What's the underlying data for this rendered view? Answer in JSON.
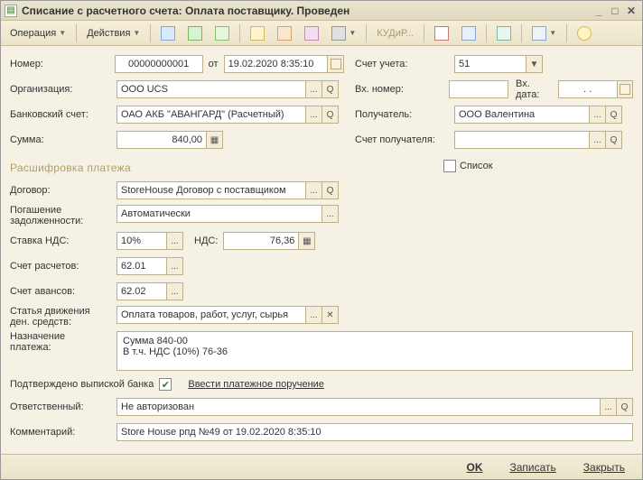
{
  "title": "Списание с расчетного счета: Оплата поставщику. Проведен",
  "toolbar": {
    "operation": "Операция",
    "actions": "Действия",
    "kudir": "КУДиР..."
  },
  "left": {
    "number_lbl": "Номер:",
    "number": "00000000001",
    "ot": "от",
    "date": "19.02.2020  8:35:10",
    "org_lbl": "Организация:",
    "org": "ООО UCS",
    "bank_lbl": "Банковский счет:",
    "bank": "ОАО АКБ \"АВАНГАРД\" (Расчетный)",
    "sum_lbl": "Сумма:",
    "sum": "840,00"
  },
  "right": {
    "account_lbl": "Счет учета:",
    "account": "51",
    "extnum_lbl": "Вх. номер:",
    "extnum": "",
    "extdate_lbl": "Вх. дата:",
    "extdate": ".  .",
    "recipient_lbl": "Получатель:",
    "recipient": "ООО Валентина",
    "recacct_lbl": "Счет получателя:",
    "recacct": ""
  },
  "section": {
    "title": "Расшифровка платежа",
    "list_chk_label": "Список",
    "contract_lbl": "Договор:",
    "contract": "StoreHouse Договор с поставщиком",
    "repay_lbl1": "Погашение",
    "repay_lbl2": "задолженности:",
    "repay": "Автоматически",
    "vatrate_lbl": "Ставка НДС:",
    "vatrate": "10%",
    "vat_lbl": "НДС:",
    "vat": "76,36",
    "settle_lbl": "Счет расчетов:",
    "settle": "62.01",
    "advance_lbl": "Счет авансов:",
    "advance": "62.02",
    "flow_lbl1": "Статья движения",
    "flow_lbl2": "ден. средств:",
    "flow": "Оплата товаров, работ, услуг, сырья",
    "purpose_lbl1": "Назначение",
    "purpose_lbl2": "платежа:",
    "purpose": "Сумма 840-00\nВ т.ч. НДС (10%) 76-36"
  },
  "bottom": {
    "bank_confirm_lbl": "Подтверждено выпиской банка",
    "link": "Ввести платежное поручение",
    "resp_lbl": "Ответственный:",
    "resp": "Не авторизован",
    "comment_lbl": "Комментарий:",
    "comment": "Store House рпд №49 от 19.02.2020 8:35:10"
  },
  "footer": {
    "ok": "OK",
    "write": "Записать",
    "close": "Закрыть"
  }
}
